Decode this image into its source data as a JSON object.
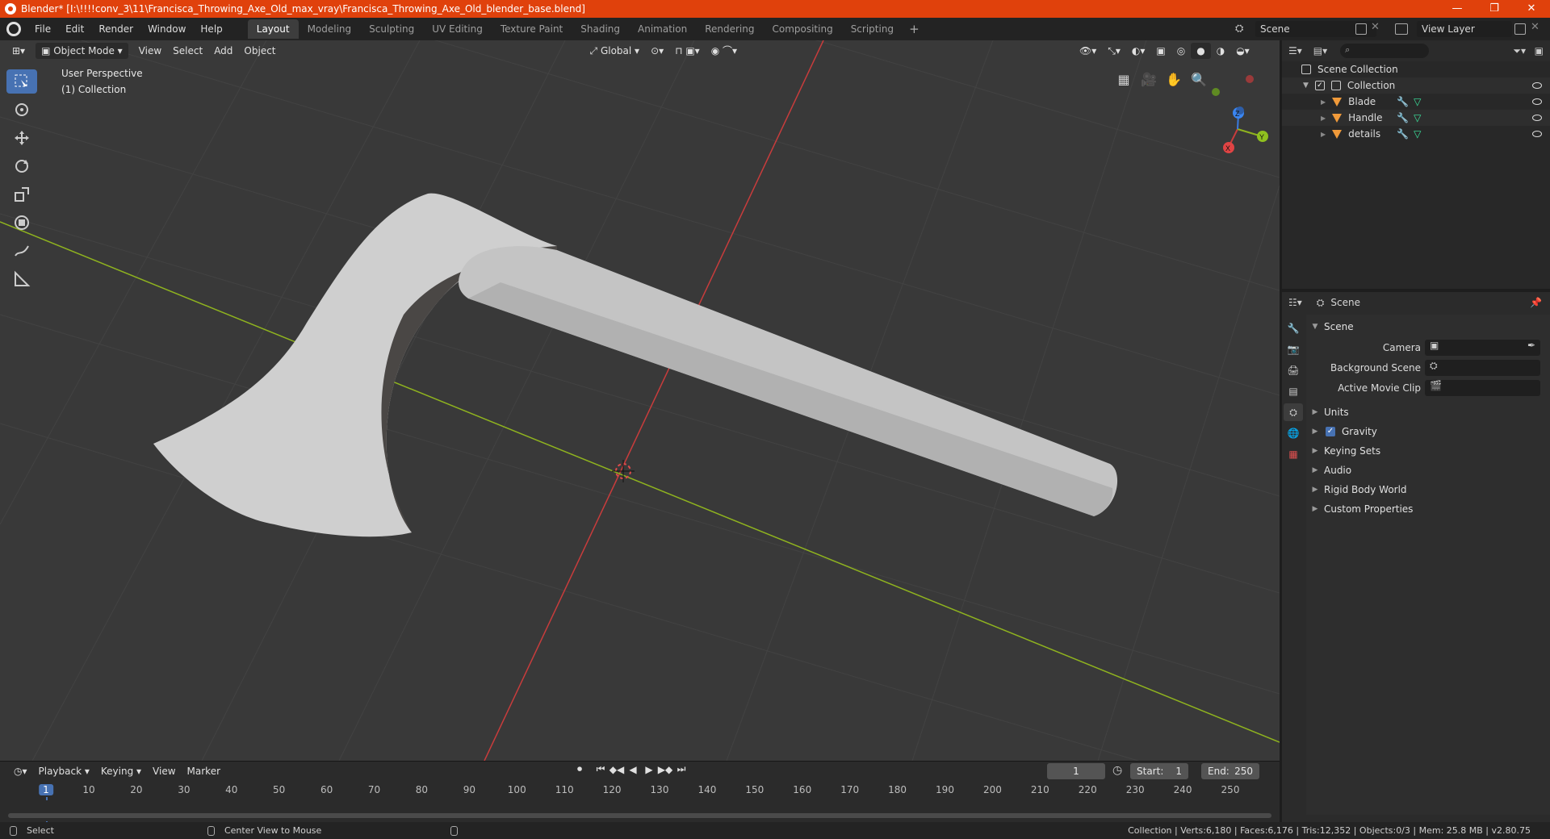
{
  "window": {
    "title": "Blender* [I:\\!!!!conv_3\\11\\Francisca_Throwing_Axe_Old_max_vray\\Francisca_Throwing_Axe_Old_blender_base.blend]",
    "minimize": "—",
    "maximize": "❐",
    "close": "✕"
  },
  "menu": [
    "File",
    "Edit",
    "Render",
    "Window",
    "Help"
  ],
  "workspaces": [
    "Layout",
    "Modeling",
    "Sculpting",
    "UV Editing",
    "Texture Paint",
    "Shading",
    "Animation",
    "Rendering",
    "Compositing",
    "Scripting"
  ],
  "active_workspace": "Layout",
  "scene_name": "Scene",
  "view_layer": "View Layer",
  "viewport": {
    "mode": "Object Mode",
    "menus": [
      "View",
      "Select",
      "Add",
      "Object"
    ],
    "transform_orientation": "Global",
    "overlay_line1": "User Perspective",
    "overlay_line2": "(1) Collection",
    "gizmo": {
      "x": "X",
      "y": "Y",
      "z": "Z"
    }
  },
  "timeline": {
    "menus": [
      "Playback",
      "Keying",
      "View",
      "Marker"
    ],
    "current_frame": "1",
    "start_label": "Start:",
    "start": "1",
    "end_label": "End:",
    "end": "250",
    "ruler": [
      "1",
      "10",
      "20",
      "30",
      "40",
      "50",
      "60",
      "70",
      "80",
      "90",
      "100",
      "110",
      "120",
      "130",
      "140",
      "150",
      "160",
      "170",
      "180",
      "190",
      "200",
      "210",
      "220",
      "230",
      "240",
      "250"
    ]
  },
  "status": {
    "left1": "Select",
    "left2": "Center View to Mouse",
    "right": "Collection | Verts:6,180 | Faces:6,176 | Tris:12,352 | Objects:0/3 | Mem: 25.8 MB | v2.80.75"
  },
  "outliner": {
    "root": "Scene Collection",
    "collection": "Collection",
    "objects": [
      "Blade",
      "Handle",
      "details"
    ]
  },
  "properties": {
    "context": "Scene",
    "panel_title": "Scene",
    "camera_label": "Camera",
    "background_scene_label": "Background Scene",
    "active_movie_clip_label": "Active Movie Clip",
    "panels": [
      "Units",
      "Gravity",
      "Keying Sets",
      "Audio",
      "Rigid Body World",
      "Custom Properties"
    ]
  },
  "colors": {
    "titlebar": "#e0410c",
    "accent": "#4772b3",
    "axis_x": "#c83c3c",
    "axis_y": "#8fb31f"
  }
}
